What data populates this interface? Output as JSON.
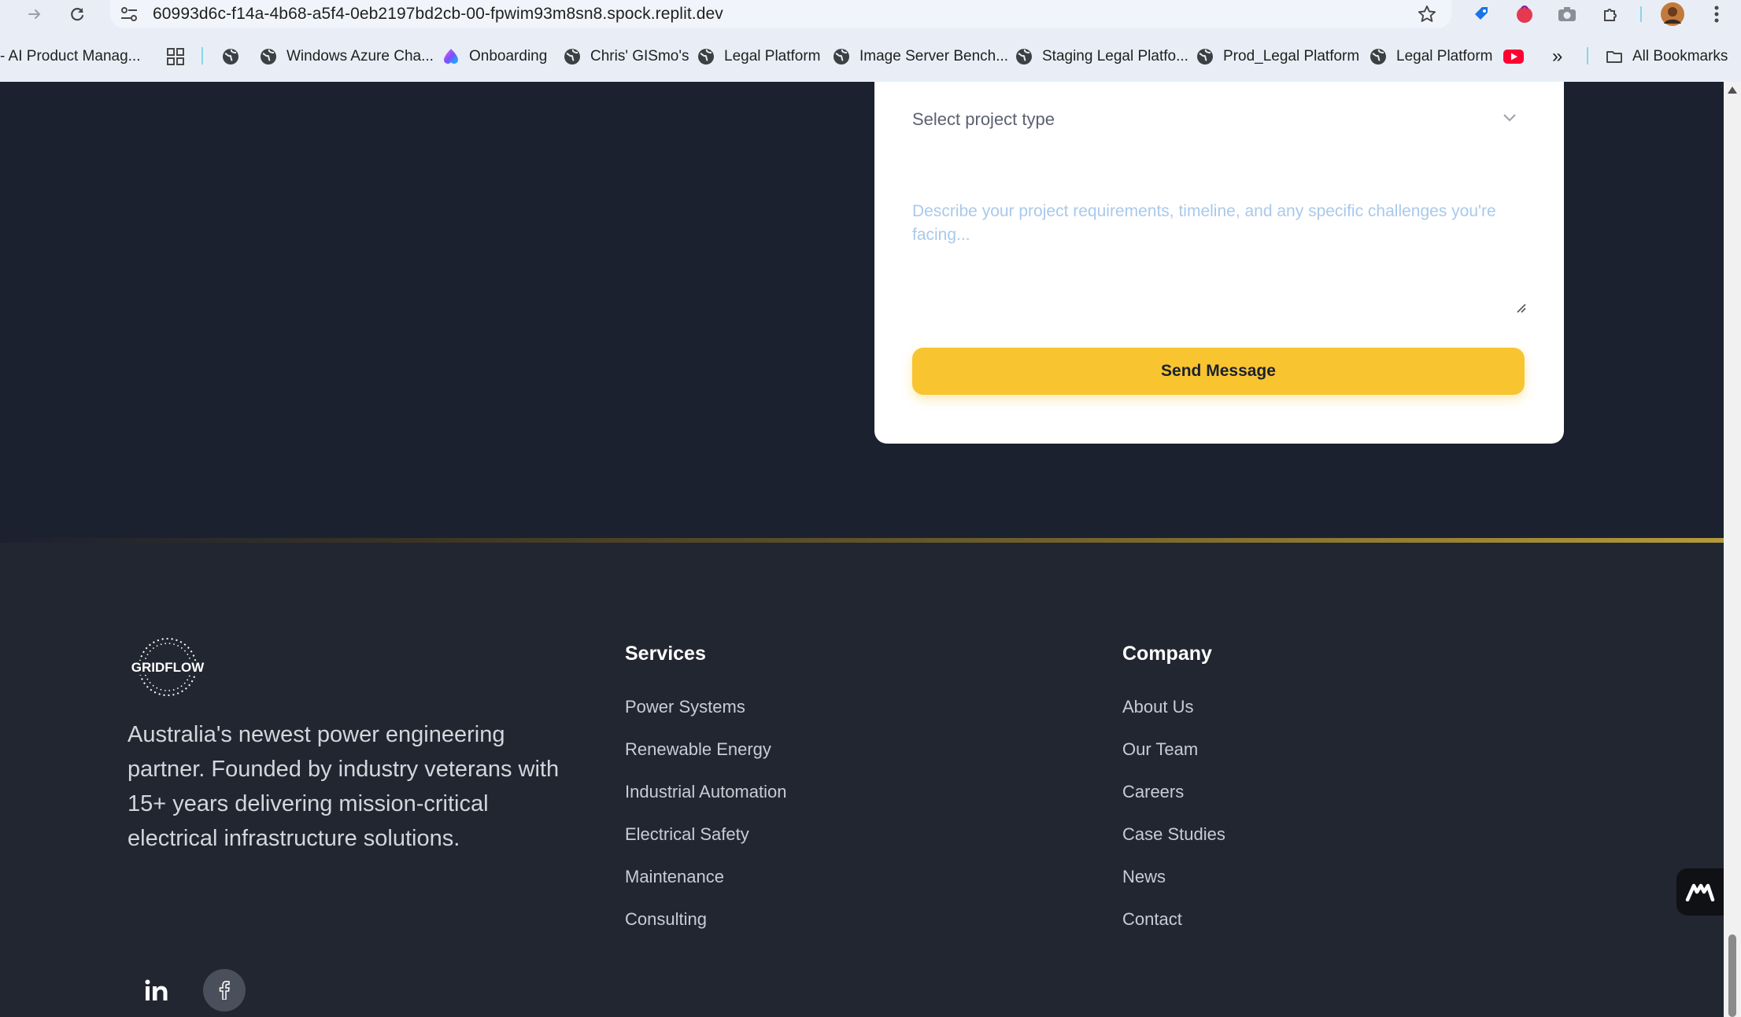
{
  "browser": {
    "url": "60993d6c-f14a-4b68-a5f4-0eb2197bd2cb-00-fpwim93m8sn8.spock.replit.dev",
    "bookmarks": [
      {
        "label": "- AI Product Manag...",
        "icon": "none"
      },
      {
        "label": "",
        "icon": "apps-grid-icon"
      },
      {
        "label": "",
        "icon": "globe-icon"
      },
      {
        "label": "Windows Azure Cha...",
        "icon": "globe-icon"
      },
      {
        "label": "Onboarding",
        "icon": "gradient-logo-icon"
      },
      {
        "label": "Chris' GISmo's",
        "icon": "globe-icon"
      },
      {
        "label": "Legal Platform",
        "icon": "globe-icon"
      },
      {
        "label": "Image Server Bench...",
        "icon": "globe-icon"
      },
      {
        "label": "Staging Legal Platfo...",
        "icon": "globe-icon"
      },
      {
        "label": "Prod_Legal Platform",
        "icon": "globe-icon"
      },
      {
        "label": "Legal Platform",
        "icon": "globe-icon"
      },
      {
        "label": "",
        "icon": "youtube-icon"
      }
    ],
    "overflow_label": "»",
    "all_bookmarks_label": "All Bookmarks"
  },
  "form": {
    "project_type_placeholder": "Select project type",
    "message_placeholder": "Describe your project requirements, timeline, and any specific challenges you're facing...",
    "submit_label": "Send Message"
  },
  "footer": {
    "brand": {
      "logo_text": "GRIDFLOW"
    },
    "about": "Australia's newest power engineering partner. Founded by industry veterans with 15+ years delivering mission-critical electrical infrastructure solutions.",
    "services": {
      "heading": "Services",
      "links": [
        "Power Systems",
        "Renewable Energy",
        "Industrial Automation",
        "Electrical Safety",
        "Maintenance",
        "Consulting"
      ]
    },
    "company": {
      "heading": "Company",
      "links": [
        "About Us",
        "Our Team",
        "Careers",
        "Case Studies",
        "News",
        "Contact"
      ]
    },
    "social": [
      "linkedin-icon",
      "facebook-icon"
    ]
  },
  "colors": {
    "page_bg": "#1c2130",
    "footer_bg": "#222631",
    "accent": "#f8c530",
    "heading": "#ffffff",
    "link": "#c9ccd4"
  }
}
